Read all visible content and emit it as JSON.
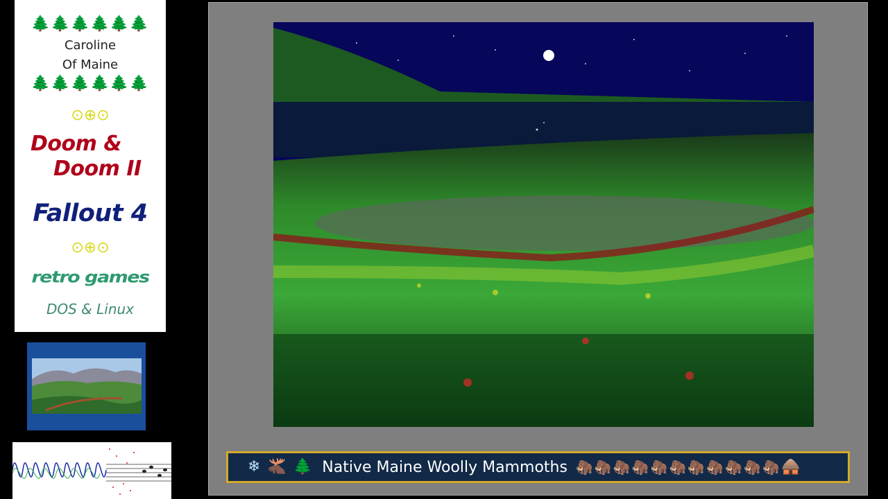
{
  "sidebar": {
    "trees_top": "🌲🌲🌲🌲🌲🌲",
    "name_line1": "Caroline",
    "name_line2": "Of Maine",
    "trees_bottom": "🌲🌲🌲🌲🌲🌲",
    "rings_1": "⊙⊕⊙",
    "doom_line1": "Doom &",
    "doom_line2": "Doom II",
    "fallout": "Fallout 4",
    "rings_2": "⊙⊕⊙",
    "retro": "retro games",
    "platforms": "DOS & Linux"
  },
  "banner": {
    "icon_1": "❄",
    "icon_2": "🫎",
    "icon_3": "🌲",
    "title": "Native Maine Woolly Mammoths",
    "mammoth_glyph": "🦣",
    "mammoth_count": 11,
    "end_icon": "🛖"
  },
  "colors": {
    "frame_grey": "#7f7f7f",
    "banner_bg": "#122a48",
    "banner_border": "#d4a92a",
    "doom_red": "#b0001a",
    "fallout_blue": "#10207a",
    "retro_green": "#2f9a6f"
  }
}
